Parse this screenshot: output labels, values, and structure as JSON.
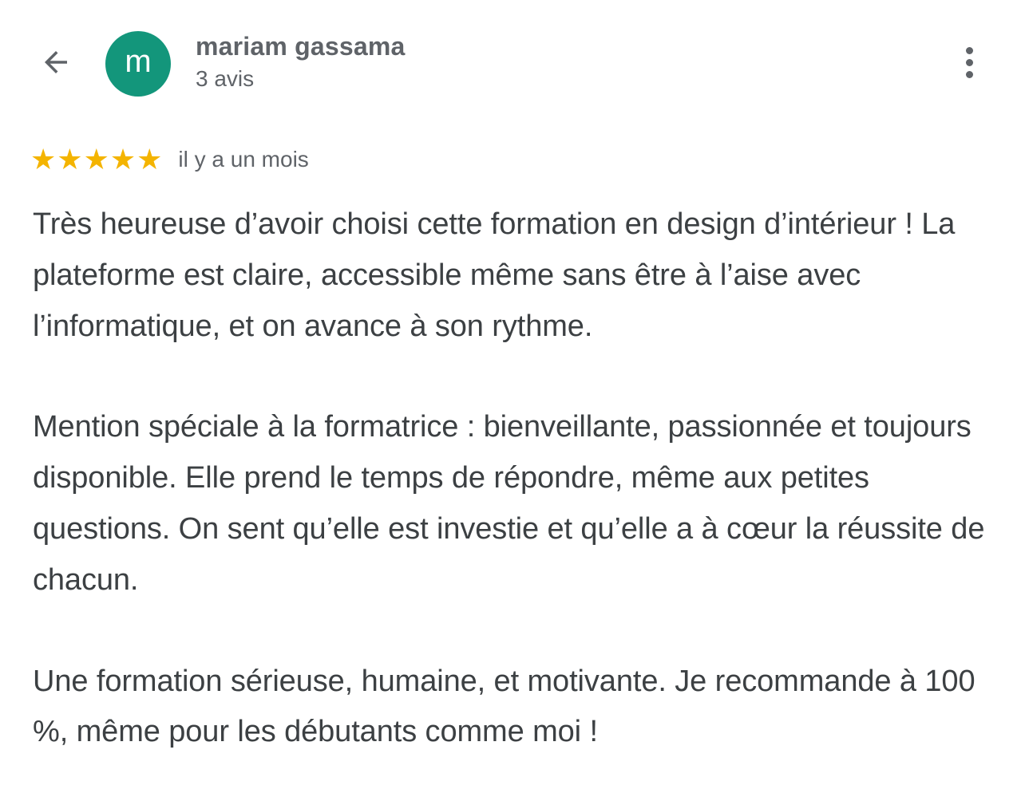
{
  "header": {
    "back_icon": "arrow-back-icon",
    "avatar_letter": "m",
    "avatar_color": "#13967b",
    "user_name": "mariam gassama",
    "review_count": "3 avis",
    "more_icon": "more-vert-icon"
  },
  "review": {
    "rating": 5,
    "max_rating": 5,
    "star_color": "#f4b400",
    "star_glyph": "★",
    "date": "il y a un mois",
    "paragraphs": [
      "Très heureuse d’avoir choisi cette formation en design d’intérieur ! La plateforme est claire, accessible même sans être à l’aise avec l’informatique, et on avance à son rythme.",
      "Mention spéciale à la formatrice : bienveillante, passionnée et toujours disponible. Elle prend le temps de répondre, même aux petites questions. On sent qu’elle est investie et qu’elle a à cœur la réussite de chacun.",
      "Une formation sérieuse, humaine, et motivante. Je recommande à 100 %, même pour les débutants comme moi !"
    ]
  }
}
